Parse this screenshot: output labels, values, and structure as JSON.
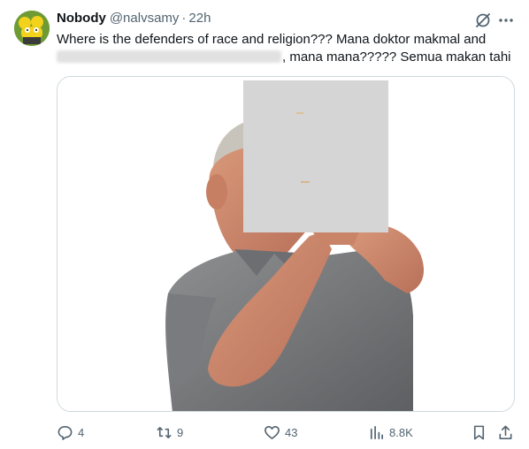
{
  "author": {
    "name": "Nobody",
    "handle": "@nalvsamy",
    "separator": "·",
    "time": "22h"
  },
  "tweet": {
    "line1": "Where is the defenders of race and religion??? Mana doktor makmal and",
    "line2_after_redaction": ", mana mana????? Semua makan tahi"
  },
  "actions": {
    "replies": "4",
    "retweets": "9",
    "likes": "43",
    "views": "8.8K"
  },
  "icons": [
    "grok-icon",
    "more-icon",
    "reply-icon",
    "retweet-icon",
    "like-icon",
    "views-icon",
    "bookmark-icon",
    "share-icon"
  ],
  "colors": {
    "text": "#0f1419",
    "secondary": "#536471",
    "border": "#cfd9de",
    "avatar_bg": "#6f9b35"
  }
}
